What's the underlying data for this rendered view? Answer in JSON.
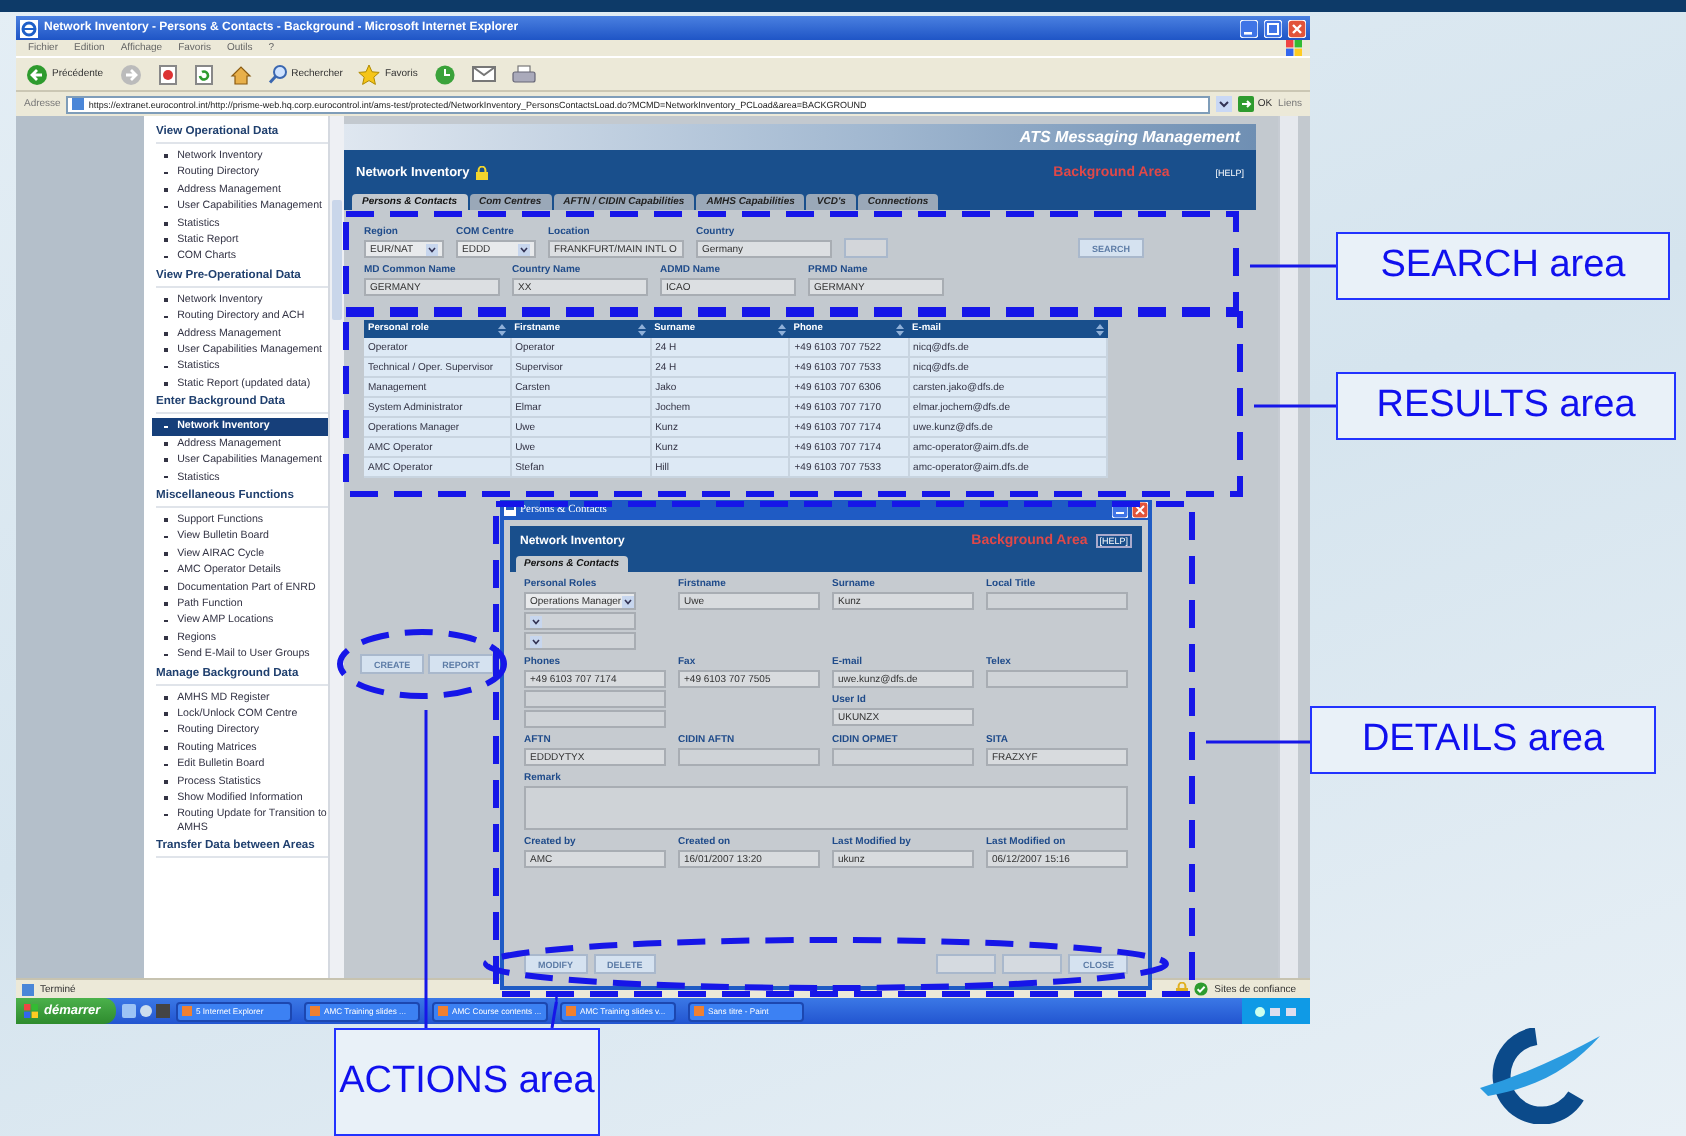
{
  "browser": {
    "title": "Network Inventory - Persons & Contacts - Background - Microsoft Internet Explorer",
    "menu": [
      "Fichier",
      "Edition",
      "Affichage",
      "Favoris",
      "Outils",
      "?"
    ],
    "toolbar": [
      {
        "kind": "back",
        "label": "Précédente"
      },
      {
        "kind": "forward"
      },
      {
        "kind": "stop"
      },
      {
        "kind": "refresh"
      },
      {
        "kind": "home"
      },
      {
        "kind": "search",
        "label": "Rechercher"
      },
      {
        "kind": "favorites",
        "label": "Favoris"
      },
      {
        "kind": "history"
      },
      {
        "kind": "mail"
      },
      {
        "kind": "print"
      }
    ],
    "address_label": "Adresse",
    "url": "https://extranet.eurocontrol.int/http://prisme-web.hq.corp.eurocontrol.int/ams-test/protected/NetworkInventory_PersonsContactsLoad.do?MCMD=NetworkInventory_PCLoad&area=BACKGROUND",
    "go": "OK",
    "links": "Liens"
  },
  "sidebar": {
    "sections": [
      {
        "title": "View Operational Data",
        "items": [
          {
            "label": "Network Inventory",
            "selected": false
          },
          {
            "label": "Routing Directory",
            "selected": false
          },
          {
            "label": "Address Management",
            "selected": false
          },
          {
            "label": "User Capabilities Management",
            "selected": false
          },
          {
            "label": "Statistics",
            "selected": false
          },
          {
            "label": "Static Report",
            "selected": false
          },
          {
            "label": "COM Charts",
            "selected": false
          }
        ]
      },
      {
        "title": "View Pre-Operational Data",
        "items": [
          {
            "label": "Network Inventory",
            "selected": false
          },
          {
            "label": "Routing Directory and ACH",
            "selected": false
          },
          {
            "label": "Address Management",
            "selected": false
          },
          {
            "label": "User Capabilities Management",
            "selected": false
          },
          {
            "label": "Statistics",
            "selected": false
          },
          {
            "label": "Static Report (updated data)",
            "selected": false
          }
        ]
      },
      {
        "title": "Enter Background Data",
        "items": [
          {
            "label": "Network Inventory",
            "selected": true
          },
          {
            "label": "Address Management",
            "selected": false
          },
          {
            "label": "User Capabilities Management",
            "selected": false
          },
          {
            "label": "Statistics",
            "selected": false
          }
        ]
      },
      {
        "title": "Miscellaneous Functions",
        "items": [
          {
            "label": "Support Functions",
            "selected": false
          },
          {
            "label": "View Bulletin Board",
            "selected": false
          },
          {
            "label": "View AIRAC Cycle",
            "selected": false
          },
          {
            "label": "AMC Operator Details",
            "selected": false
          },
          {
            "label": "Documentation Part of ENRD",
            "selected": false
          },
          {
            "label": "Path Function",
            "selected": false
          },
          {
            "label": "View AMP Locations",
            "selected": false
          },
          {
            "label": "Regions",
            "selected": false
          },
          {
            "label": "Send E-Mail to User Groups",
            "selected": false
          }
        ]
      },
      {
        "title": "Manage Background Data",
        "items": [
          {
            "label": "AMHS MD Register",
            "selected": false
          },
          {
            "label": "Lock/Unlock COM Centre",
            "selected": false
          },
          {
            "label": "Routing Directory",
            "selected": false
          },
          {
            "label": "Routing Matrices",
            "selected": false
          },
          {
            "label": "Edit Bulletin Board",
            "selected": false
          },
          {
            "label": "Process Statistics",
            "selected": false
          },
          {
            "label": "Show Modified Information",
            "selected": false
          },
          {
            "label": "Routing Update for Transition to AMHS",
            "selected": false
          }
        ]
      },
      {
        "title": "Transfer Data between Areas"
      }
    ]
  },
  "app": {
    "banner": "ATS Messaging Management",
    "title": "Network Inventory",
    "area": "Background Area",
    "help": "[HELP]",
    "tabs": [
      {
        "label": "Persons & Contacts",
        "selected": true
      },
      {
        "label": "Com Centres",
        "selected": false
      },
      {
        "label": "AFTN / CIDIN Capabilities",
        "selected": false
      },
      {
        "label": "AMHS Capabilities",
        "selected": false
      },
      {
        "label": "VCD's",
        "selected": false
      },
      {
        "label": "Connections",
        "selected": false
      }
    ]
  },
  "search": {
    "rows": [
      [
        {
          "kind": "select",
          "label": "Region",
          "value": "EUR/NAT"
        },
        {
          "kind": "select",
          "label": "COM Centre",
          "value": "EDDD"
        },
        {
          "kind": "text",
          "label": "Location",
          "value": "FRANKFURT/MAIN INTL O"
        },
        {
          "kind": "text",
          "label": "Country",
          "value": "Germany"
        },
        {
          "kind": "button",
          "disabled": true
        }
      ],
      [
        {
          "kind": "text",
          "label": "MD Common Name",
          "value": "GERMANY"
        },
        {
          "kind": "text",
          "label": "Country Name",
          "value": "XX"
        },
        {
          "kind": "text",
          "label": "ADMD Name",
          "value": "ICAO"
        },
        {
          "kind": "text",
          "label": "PRMD Name",
          "value": "GERMANY"
        }
      ]
    ],
    "search_button": "SEARCH"
  },
  "results": {
    "columns": [
      "Personal role",
      "Firstname",
      "Surname",
      "Phone",
      "E-mail"
    ],
    "rows": [
      [
        "Operator",
        "Operator",
        "24 H",
        "+49 6103 707 7522",
        "nicq@dfs.de"
      ],
      [
        "Technical / Oper. Supervisor",
        "Supervisor",
        "24 H",
        "+49 6103 707 7533",
        "nicq@dfs.de"
      ],
      [
        "Management",
        "Carsten",
        "Jako",
        "+49 6103 707 6306",
        "carsten.jako@dfs.de"
      ],
      [
        "System Administrator",
        "Elmar",
        "Jochem",
        "+49 6103 707 7170",
        "elmar.jochem@dfs.de"
      ],
      [
        "Operations Manager",
        "Uwe",
        "Kunz",
        "+49 6103 707 7174",
        "uwe.kunz@dfs.de"
      ],
      [
        "AMC Operator",
        "Uwe",
        "Kunz",
        "+49 6103 707 7174",
        "amc-operator@aim.dfs.de"
      ],
      [
        "AMC Operator",
        "Stefan",
        "Hill",
        "+49 6103 707 7533",
        "amc-operator@aim.dfs.de"
      ]
    ]
  },
  "list_buttons": [
    {
      "label": "CREATE"
    },
    {
      "label": "REPORT"
    }
  ],
  "details": {
    "window_title": "Persons & Contacts",
    "title": "Network Inventory",
    "area": "Background Area",
    "help": "[HELP]",
    "tab": {
      "label": "Persons & Contacts",
      "selected": true
    },
    "rows": [
      [
        [
          {
            "label": "Personal Roles",
            "kind": "select",
            "inputs": [
              {
                "kind": "filled",
                "value": "Operations Manager"
              },
              {
                "kind": "empty"
              },
              {
                "kind": "empty"
              }
            ]
          }
        ],
        [
          {
            "label": "Firstname",
            "kind": "text",
            "inputs": [
              {
                "value": "Uwe"
              }
            ]
          }
        ],
        [
          {
            "label": "Surname",
            "kind": "text",
            "inputs": [
              {
                "value": "Kunz"
              }
            ]
          }
        ],
        [
          {
            "label": "Local Title",
            "kind": "text",
            "inputs": [
              {
                "kind": "empty"
              }
            ]
          }
        ]
      ],
      [
        [
          {
            "label": "Phones",
            "kind": "text",
            "inputs": [
              {
                "kind": "filled",
                "value": "+49 6103 707 7174"
              },
              {
                "kind": "empty"
              },
              {
                "kind": "empty"
              }
            ]
          }
        ],
        [
          {
            "label": "Fax",
            "kind": "text",
            "inputs": [
              {
                "value": "+49 6103 707 7505"
              }
            ]
          }
        ],
        [
          {
            "label": "E-mail",
            "kind": "text",
            "inputs": [
              {
                "value": "uwe.kunz@dfs.de"
              }
            ]
          },
          {
            "label": "User Id",
            "kind": "text",
            "inputs": [
              {
                "value": "UKUNZX"
              }
            ]
          }
        ],
        [
          {
            "label": "Telex",
            "kind": "text",
            "inputs": [
              {
                "kind": "empty"
              }
            ]
          }
        ]
      ],
      [
        [
          {
            "label": "AFTN",
            "kind": "text",
            "inputs": [
              {
                "value": "EDDDYTYX"
              }
            ]
          }
        ],
        [
          {
            "label": "CIDIN AFTN",
            "kind": "text",
            "inputs": [
              {
                "kind": "empty"
              }
            ]
          }
        ],
        [
          {
            "label": "CIDIN OPMET",
            "kind": "text",
            "inputs": [
              {
                "kind": "empty"
              }
            ]
          }
        ],
        [
          {
            "label": "SITA",
            "kind": "text",
            "inputs": [
              {
                "value": "FRAZXYF"
              }
            ]
          }
        ]
      ],
      [
        [
          {
            "label": "Remark",
            "kind": "textarea",
            "inputs": [
              {
                "kind": "empty"
              }
            ]
          }
        ]
      ],
      [
        [
          {
            "label": "Created by",
            "kind": "text",
            "inputs": [
              {
                "value": "AMC"
              }
            ]
          }
        ],
        [
          {
            "label": "Created on",
            "kind": "text",
            "inputs": [
              {
                "value": "16/01/2007 13:20"
              }
            ]
          }
        ],
        [
          {
            "label": "Last Modified by",
            "kind": "text",
            "inputs": [
              {
                "value": "ukunz"
              }
            ]
          }
        ],
        [
          {
            "label": "Last Modified on",
            "kind": "text",
            "inputs": [
              {
                "value": "06/12/2007 15:16"
              }
            ]
          }
        ]
      ]
    ],
    "left_buttons": [
      {
        "label": "MODIFY",
        "disabled": false
      },
      {
        "label": "DELETE",
        "disabled": false
      }
    ],
    "right_buttons": [
      {
        "disabled": true
      },
      {
        "disabled": true
      },
      {
        "label": "CLOSE",
        "disabled": false
      }
    ]
  },
  "status_bar": {
    "text": "Terminé",
    "zone": "Sites de confiance"
  },
  "taskbar": {
    "start": "démarrer",
    "tasks": [
      "5 Internet Explorer",
      "AMC Training slides ...",
      "AMC Course contents ...",
      "AMC Training slides v...",
      "Sans titre - Paint"
    ]
  },
  "callouts": [
    {
      "label": "SEARCH area",
      "kind": "rect"
    },
    {
      "label": "RESULTS area",
      "kind": "rect"
    },
    {
      "label": "DETAILS area",
      "kind": "rect"
    },
    {
      "label": "ACTIONS area",
      "kind": "ellipses"
    }
  ]
}
